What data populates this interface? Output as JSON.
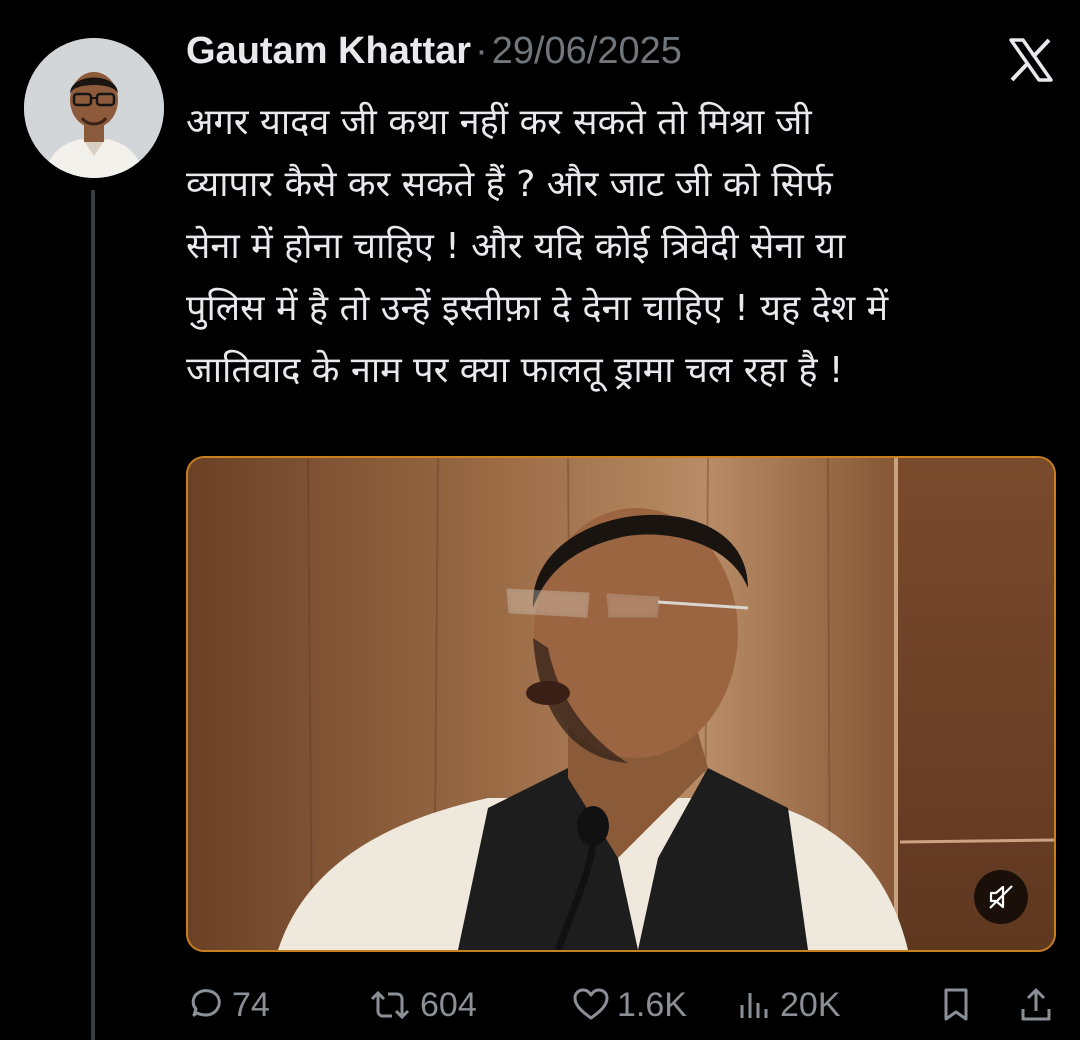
{
  "tweet": {
    "author_name": "Gautam Khattar",
    "separator": "·",
    "date": "29/06/2025",
    "text_lines": [
      "अगर यादव जी कथा नहीं कर सकते तो मिश्रा जी",
      "व्यापार कैसे कर सकते हैं ? और जाट जी को सिर्फ",
      "सेना में होना चाहिए ! और यदि कोई त्रिवेदी सेना या",
      "पुलिस में है तो उन्हें इस्तीफ़ा दे देना चाहिए ! यह देश में",
      "जातिवाद के नाम पर क्या फालतू ड्रामा चल रहा है !"
    ]
  },
  "media": {
    "type": "video",
    "muted": true
  },
  "actions": {
    "replies": "74",
    "reposts": "604",
    "likes": "1.6K",
    "views": "20K"
  },
  "colors": {
    "background": "#000000",
    "text": "#e7e9ea",
    "muted_text": "#71767b",
    "action_gray": "#8b9096",
    "media_border": "#c7801f"
  },
  "icons": [
    "x-logo-icon",
    "mute-icon",
    "reply-icon",
    "repost-icon",
    "like-icon",
    "views-icon",
    "bookmark-icon",
    "share-icon"
  ]
}
